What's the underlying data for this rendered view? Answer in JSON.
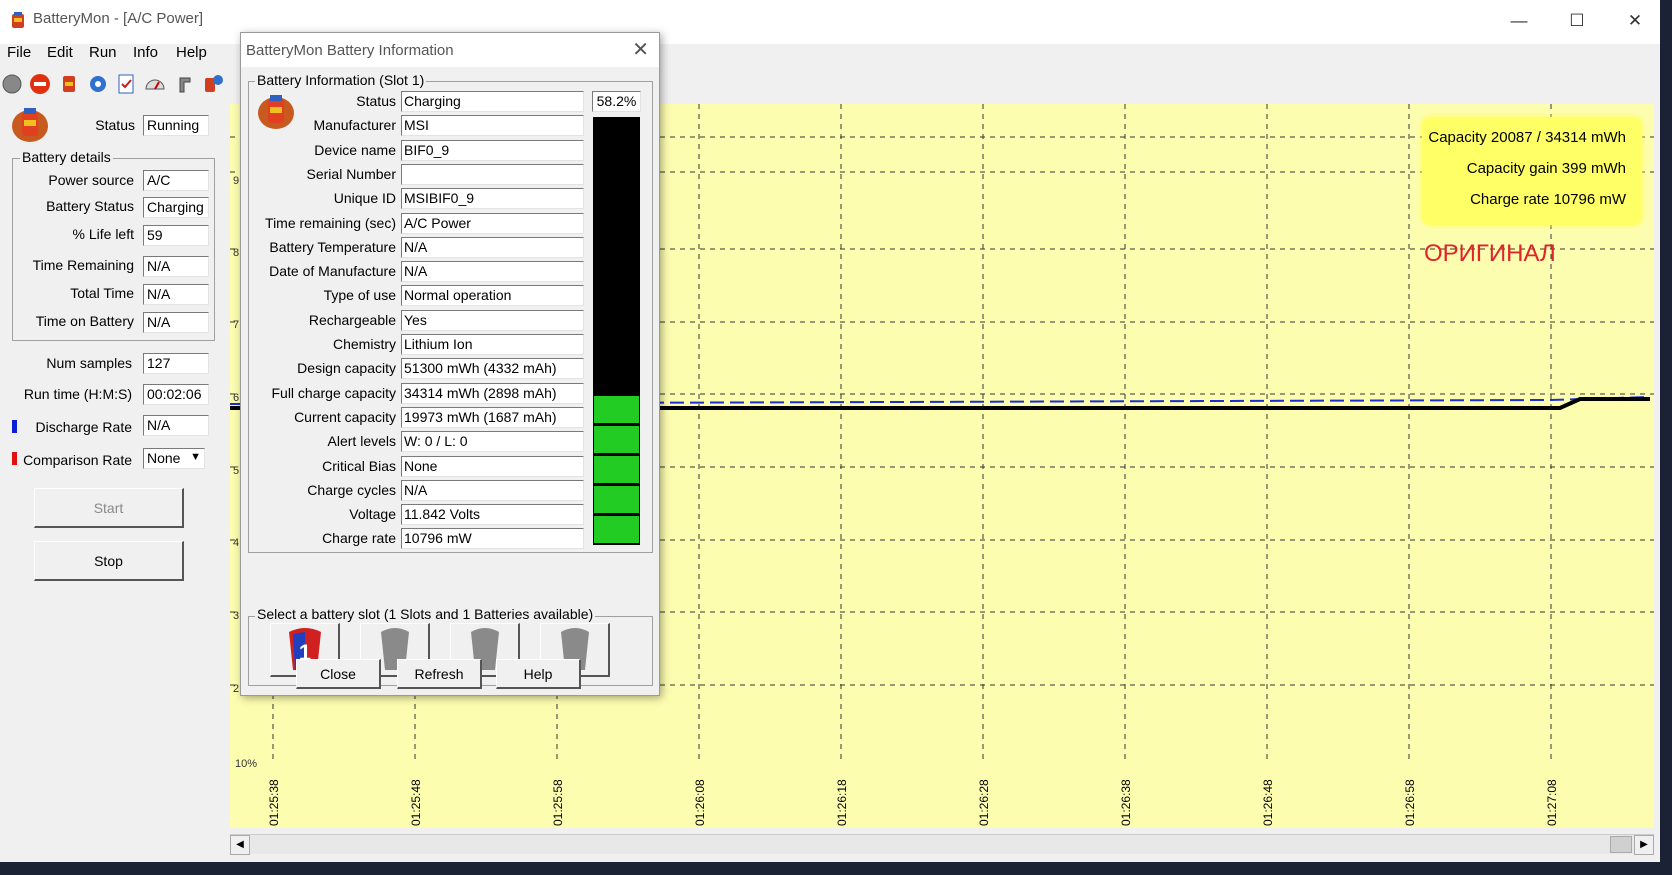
{
  "window": {
    "title": "BatteryMon - [A/C Power]",
    "minimize": "—",
    "maximize": "☐",
    "close": "✕"
  },
  "menu": [
    "File",
    "Edit",
    "Run",
    "Info",
    "Help"
  ],
  "toolbar_icons": [
    "record-icon",
    "stop-icon",
    "battery-icon",
    "settings-icon",
    "checklist-icon",
    "gauge-icon",
    "pointer-icon",
    "battery-info-icon"
  ],
  "left_panel": {
    "status_label": "Status",
    "status_value": "Running",
    "group_title": "Battery details",
    "details": [
      {
        "label": "Power source",
        "value": "A/C"
      },
      {
        "label": "Battery Status",
        "value": "Charging"
      },
      {
        "label": "% Life left",
        "value": "59"
      },
      {
        "label": "Time Remaining",
        "value": "N/A"
      },
      {
        "label": "Total Time",
        "value": "N/A"
      },
      {
        "label": "Time on Battery",
        "value": "N/A"
      }
    ],
    "num_samples_label": "Num samples",
    "num_samples": "127",
    "run_time_label": "Run time (H:M:S)",
    "run_time": "00:02:06",
    "discharge_rate_label": "Discharge Rate",
    "discharge_rate": "N/A",
    "comparison_rate_label": "Comparison Rate",
    "comparison_rate": "None",
    "start_label": "Start",
    "stop_label": "Stop",
    "discharge_color": "#0a1fd6",
    "comparison_color": "#e01010"
  },
  "chart": {
    "background": "#fdfdb0",
    "y_axis_bottom_label": "10%",
    "x_ticks": [
      "01:25:38",
      "01:25:48",
      "01:25:58",
      "01:26:08",
      "01:26:18",
      "01:26:28",
      "01:26:38",
      "01:26:48",
      "01:26:58",
      "01:27:08"
    ],
    "legend": [
      "Capacity 20087 / 34314 mWh",
      "Capacity gain 399 mWh",
      "Charge rate 10796 mW"
    ],
    "watermark": "ОРИГИНАЛ",
    "partial_y_digits": [
      "9",
      "8",
      "7",
      "6",
      "5",
      "4",
      "3",
      "2"
    ]
  },
  "dialog": {
    "title": "BatteryMon Battery Information",
    "group_title": "Battery Information (Slot 1)",
    "percent": "58.2%",
    "percent_fill": 0.582,
    "rows": [
      {
        "label": "Status",
        "value": "Charging"
      },
      {
        "label": "Manufacturer",
        "value": "MSI"
      },
      {
        "label": "Device name",
        "value": "BIF0_9"
      },
      {
        "label": "Serial Number",
        "value": ""
      },
      {
        "label": "Unique ID",
        "value": "MSIBIF0_9"
      },
      {
        "label": "Time remaining (sec)",
        "value": "A/C Power"
      },
      {
        "label": "Battery Temperature",
        "value": "N/A"
      },
      {
        "label": "Date of Manufacture",
        "value": "N/A"
      },
      {
        "label": "Type of use",
        "value": "Normal operation"
      },
      {
        "label": "Rechargeable",
        "value": "Yes"
      },
      {
        "label": "Chemistry",
        "value": "Lithium Ion"
      },
      {
        "label": "Design capacity",
        "value": "51300 mWh (4332 mAh)"
      },
      {
        "label": "Full charge capacity",
        "value": "34314 mWh (2898 mAh)"
      },
      {
        "label": "Current capacity",
        "value": "19973 mWh (1687 mAh)"
      },
      {
        "label": "Alert levels",
        "value": "W: 0 / L: 0"
      },
      {
        "label": "Critical Bias",
        "value": "None"
      },
      {
        "label": "Charge cycles",
        "value": "N/A"
      },
      {
        "label": "Voltage",
        "value": "11.842 Volts"
      },
      {
        "label": "Charge rate",
        "value": "10796 mW"
      }
    ],
    "slot_group_title": "Select a battery slot (1 Slots and 1 Batteries available)",
    "slot_1_label": "1",
    "close_label": "Close",
    "refresh_label": "Refresh",
    "help_label": "Help",
    "gauge_fill_color": "#22cc22",
    "gauge_empty_color": "#000000"
  }
}
